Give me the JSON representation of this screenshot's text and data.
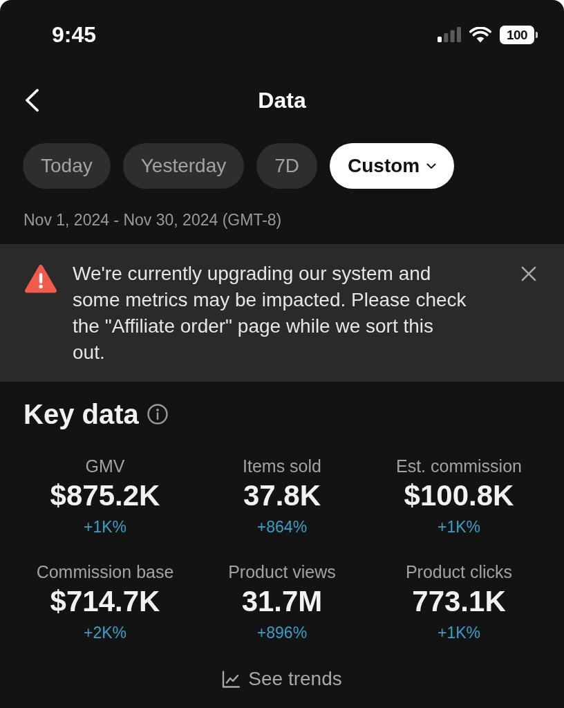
{
  "status_bar": {
    "time": "9:45",
    "battery": "100"
  },
  "header": {
    "title": "Data"
  },
  "tabs": [
    {
      "label": "Today",
      "selected": false,
      "kind": "plain"
    },
    {
      "label": "Yesterday",
      "selected": false,
      "kind": "plain"
    },
    {
      "label": "7D",
      "selected": false,
      "kind": "plain"
    },
    {
      "label": "Custom",
      "selected": true,
      "kind": "dropdown"
    }
  ],
  "date_range": "Nov 1, 2024 - Nov 30, 2024 (GMT-8)",
  "banner": {
    "message": "We're currently upgrading our system and some metrics may be impacted. Please check the \"Affiliate order\" page while we sort this out."
  },
  "key_data": {
    "title": "Key data",
    "metrics": [
      {
        "label": "GMV",
        "value": "$875.2K",
        "change": "+1K%"
      },
      {
        "label": "Items sold",
        "value": "37.8K",
        "change": "+864%"
      },
      {
        "label": "Est. commission",
        "value": "$100.8K",
        "change": "+1K%"
      },
      {
        "label": "Commission base",
        "value": "$714.7K",
        "change": "+2K%"
      },
      {
        "label": "Product views",
        "value": "31.7M",
        "change": "+896%"
      },
      {
        "label": "Product clicks",
        "value": "773.1K",
        "change": "+1K%"
      }
    ]
  },
  "see_trends": "See trends"
}
